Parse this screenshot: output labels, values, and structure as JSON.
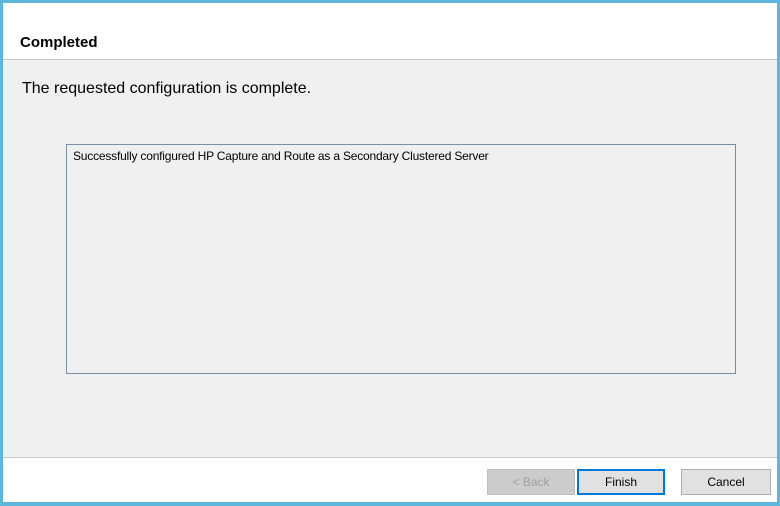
{
  "header": {
    "title": "Completed"
  },
  "main": {
    "description": "The requested configuration is complete.",
    "results": {
      "text": "Successfully configured HP Capture and Route as a Secondary Clustered Server"
    }
  },
  "footer": {
    "back_label": "< Back",
    "finish_label": "Finish",
    "cancel_label": "Cancel"
  },
  "colors": {
    "window_border": "#5fb6dc",
    "panel_background": "#f0f0f0",
    "default_button_border": "#0078d7"
  }
}
